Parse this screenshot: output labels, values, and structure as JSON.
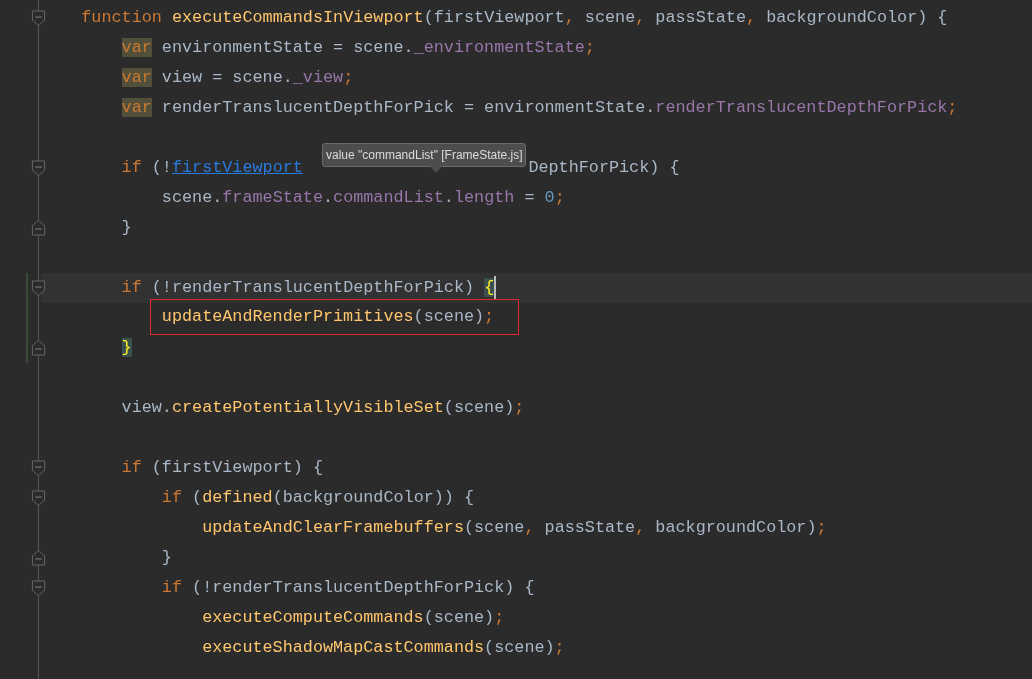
{
  "editor": {
    "lines": [
      {
        "kind": "code",
        "fold_start": true,
        "tokens": [
          {
            "text": "function",
            "kind": "kw"
          },
          {
            "text": " executeCommandsInViewport",
            "kind": "fn"
          },
          {
            "text": "(firstViewport",
            "kind": "plain"
          },
          {
            "text": ",",
            "kind": "kw"
          },
          {
            "text": " scene",
            "kind": "plain"
          },
          {
            "text": ",",
            "kind": "kw"
          },
          {
            "text": " passState",
            "kind": "plain"
          },
          {
            "text": ",",
            "kind": "kw"
          },
          {
            "text": " backgroundColor) {",
            "kind": "plain"
          }
        ],
        "children": [
          {
            "kind": "code",
            "tokens": [
              {
                "text": "var",
                "kind": "kw_marked"
              },
              {
                "text": " environmentState = scene.",
                "kind": "plain"
              },
              {
                "text": "_environmentState",
                "kind": "field"
              },
              {
                "text": ";",
                "kind": "kw"
              }
            ]
          },
          {
            "kind": "code",
            "tokens": [
              {
                "text": "var",
                "kind": "kw_marked"
              },
              {
                "text": " view = scene.",
                "kind": "plain"
              },
              {
                "text": "_view",
                "kind": "field"
              },
              {
                "text": ";",
                "kind": "kw"
              }
            ]
          },
          {
            "kind": "code",
            "tokens": [
              {
                "text": "var",
                "kind": "kw_marked"
              },
              {
                "text": " renderTranslucentDepthForPick = environmentState.",
                "kind": "plain"
              },
              {
                "text": "renderTranslucentDepthForPick",
                "kind": "field"
              },
              {
                "text": ";",
                "kind": "kw"
              }
            ]
          },
          {
            "kind": "blank"
          },
          {
            "kind": "code",
            "fold_start": true,
            "tokens": [
              {
                "text": "if",
                "kind": "kw"
              },
              {
                "text": " (!",
                "kind": "plain"
              },
              {
                "text": "firstViewport",
                "kind": "link"
              },
              {
                "text": "DepthForPick) {",
                "kind": "plain",
                "behind_tooltip": true
              }
            ],
            "children": [
              {
                "kind": "code",
                "tokens": [
                  {
                    "text": "scene.",
                    "kind": "plain"
                  },
                  {
                    "text": "frameState",
                    "kind": "field"
                  },
                  {
                    "text": ".",
                    "kind": "plain"
                  },
                  {
                    "text": "commandList",
                    "kind": "field"
                  },
                  {
                    "text": ".",
                    "kind": "plain"
                  },
                  {
                    "text": "length",
                    "kind": "field"
                  },
                  {
                    "text": " = ",
                    "kind": "plain"
                  },
                  {
                    "text": "0",
                    "kind": "num"
                  },
                  {
                    "text": ";",
                    "kind": "kw"
                  }
                ]
              }
            ]
          },
          {
            "kind": "code",
            "fold_end": true,
            "tokens": [
              {
                "text": "}",
                "kind": "plain"
              }
            ]
          },
          {
            "kind": "blank"
          },
          {
            "kind": "code",
            "fold_start": true,
            "changed": true,
            "current": true,
            "tokens": [
              {
                "text": "if",
                "kind": "kw"
              },
              {
                "text": " (!renderTranslucentDepthForPick) ",
                "kind": "plain"
              },
              {
                "text": "{",
                "kind": "brace"
              }
            ],
            "children": [
              {
                "kind": "code",
                "changed": true,
                "boxed": true,
                "tokens": [
                  {
                    "text": "updateAndRenderPrimitives",
                    "kind": "fn"
                  },
                  {
                    "text": "(scene)",
                    "kind": "plain"
                  },
                  {
                    "text": ";",
                    "kind": "kw"
                  }
                ]
              }
            ]
          },
          {
            "kind": "code",
            "fold_end": true,
            "changed": true,
            "tokens": [
              {
                "text": "}",
                "kind": "brace"
              }
            ]
          },
          {
            "kind": "blank"
          },
          {
            "kind": "code",
            "tokens": [
              {
                "text": "view.",
                "kind": "plain"
              },
              {
                "text": "createPotentiallyVisibleSet",
                "kind": "fn"
              },
              {
                "text": "(scene)",
                "kind": "plain"
              },
              {
                "text": ";",
                "kind": "kw"
              }
            ]
          },
          {
            "kind": "blank"
          },
          {
            "kind": "code",
            "fold_start": true,
            "tokens": [
              {
                "text": "if",
                "kind": "kw"
              },
              {
                "text": " (firstViewport) {",
                "kind": "plain"
              }
            ],
            "children": [
              {
                "kind": "code",
                "fold_start": true,
                "tokens": [
                  {
                    "text": "if",
                    "kind": "kw"
                  },
                  {
                    "text": " (",
                    "kind": "plain"
                  },
                  {
                    "text": "defined",
                    "kind": "fn"
                  },
                  {
                    "text": "(backgroundColor)) {",
                    "kind": "plain"
                  }
                ],
                "children": [
                  {
                    "kind": "code",
                    "tokens": [
                      {
                        "text": "updateAndClearFramebuffers",
                        "kind": "fn"
                      },
                      {
                        "text": "(scene",
                        "kind": "plain"
                      },
                      {
                        "text": ",",
                        "kind": "kw"
                      },
                      {
                        "text": " passState",
                        "kind": "plain"
                      },
                      {
                        "text": ",",
                        "kind": "kw"
                      },
                      {
                        "text": " backgroundColor)",
                        "kind": "plain"
                      },
                      {
                        "text": ";",
                        "kind": "kw"
                      }
                    ]
                  }
                ]
              },
              {
                "kind": "code",
                "fold_end": true,
                "tokens": [
                  {
                    "text": "}",
                    "kind": "plain"
                  }
                ]
              },
              {
                "kind": "code",
                "fold_start": true,
                "tokens": [
                  {
                    "text": "if",
                    "kind": "kw"
                  },
                  {
                    "text": " (!renderTranslucentDepthForPick) {",
                    "kind": "plain"
                  }
                ],
                "children": [
                  {
                    "kind": "code",
                    "tokens": [
                      {
                        "text": "executeComputeCommands",
                        "kind": "fn"
                      },
                      {
                        "text": "(scene)",
                        "kind": "plain"
                      },
                      {
                        "text": ";",
                        "kind": "kw"
                      }
                    ]
                  },
                  {
                    "kind": "code",
                    "tokens": [
                      {
                        "text": "executeShadowMapCastCommands",
                        "kind": "fn"
                      },
                      {
                        "text": "(scene)",
                        "kind": "plain"
                      },
                      {
                        "text": ";",
                        "kind": "kw"
                      }
                    ]
                  }
                ]
              }
            ]
          }
        ]
      }
    ]
  },
  "tooltip": {
    "text": "value \"commandList\" [FrameState.js]"
  }
}
